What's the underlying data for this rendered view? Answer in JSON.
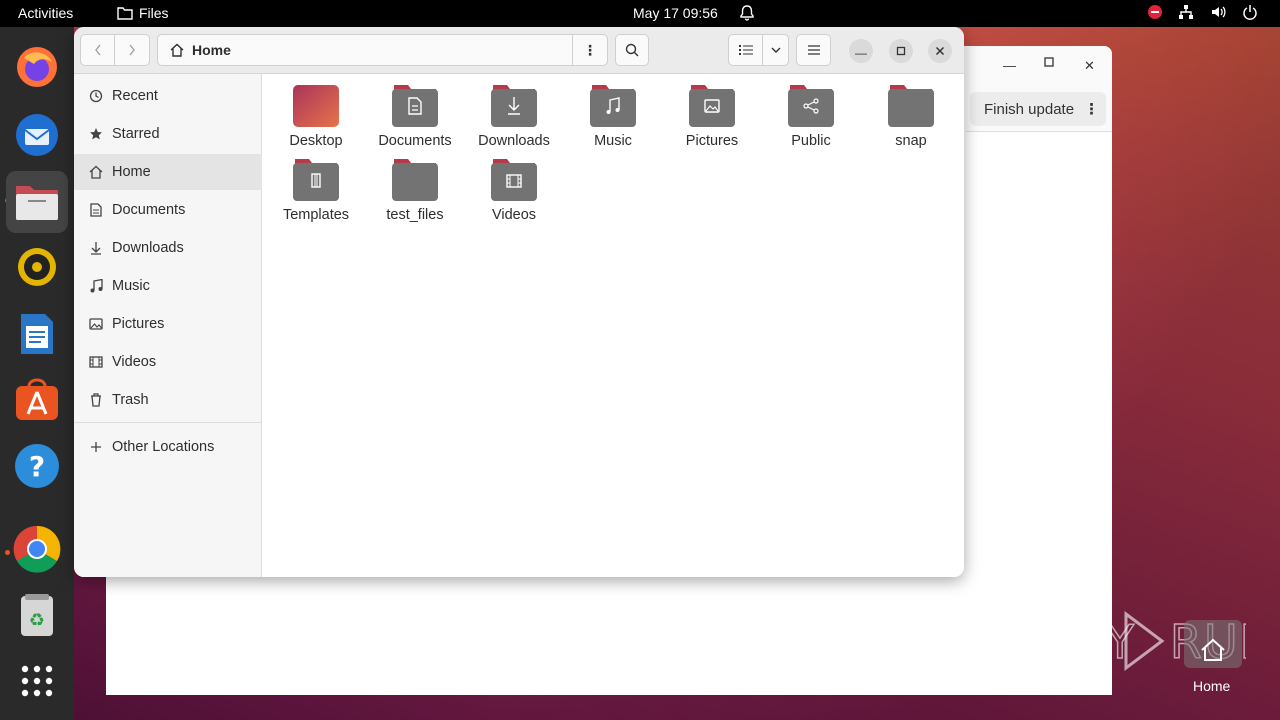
{
  "topbar": {
    "activities": "Activities",
    "app_name": "Files",
    "clock": "May 17  09:56"
  },
  "dock": {
    "apps": [
      "firefox",
      "thunderbird",
      "files",
      "rhythmbox",
      "libreoffice-writer",
      "app-center",
      "help",
      "chrome",
      "trash",
      "app-grid"
    ]
  },
  "background_window": {
    "finish_update_label": "Finish update"
  },
  "files_window": {
    "path": "Home",
    "sidebar": [
      {
        "label": "Recent",
        "icon": "clock-icon"
      },
      {
        "label": "Starred",
        "icon": "star-icon"
      },
      {
        "label": "Home",
        "icon": "home-icon",
        "active": true
      },
      {
        "label": "Documents",
        "icon": "document-icon"
      },
      {
        "label": "Downloads",
        "icon": "download-icon"
      },
      {
        "label": "Music",
        "icon": "music-icon"
      },
      {
        "label": "Pictures",
        "icon": "picture-icon"
      },
      {
        "label": "Videos",
        "icon": "video-icon"
      },
      {
        "label": "Trash",
        "icon": "trash-icon"
      },
      {
        "label": "Other Locations",
        "icon": "plus-icon"
      }
    ],
    "folders": [
      {
        "label": "Desktop",
        "emblem": "desktop"
      },
      {
        "label": "Documents",
        "emblem": "document"
      },
      {
        "label": "Downloads",
        "emblem": "download"
      },
      {
        "label": "Music",
        "emblem": "music"
      },
      {
        "label": "Pictures",
        "emblem": "picture"
      },
      {
        "label": "Public",
        "emblem": "share"
      },
      {
        "label": "snap",
        "emblem": "none"
      },
      {
        "label": "Templates",
        "emblem": "template"
      },
      {
        "label": "test_files",
        "emblem": "none"
      },
      {
        "label": "Videos",
        "emblem": "video"
      }
    ]
  },
  "desktop": {
    "watermark": "ANY RUN",
    "home_label": "Home"
  },
  "colors": {
    "accent": "#e95420",
    "folder_top": "#b53a4a",
    "folder_body": "#737373"
  }
}
